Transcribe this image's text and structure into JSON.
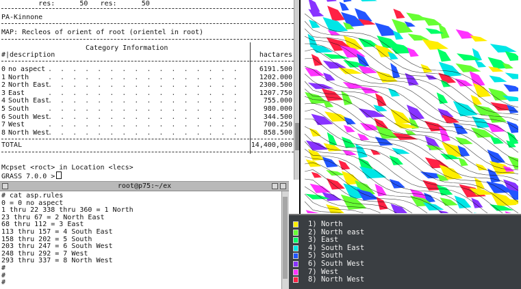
{
  "report": {
    "res_line": "         res:      50   res:      50",
    "mapset_label": "PA-Kinnone",
    "map_label": "MAP: Recleos of orient of root (orientel in root)",
    "category_header": "Category Information",
    "col_desc": "#|description",
    "col_hectares": "hactares",
    "rows": [
      {
        "num": "0",
        "desc": "no aspect",
        "value": "6191.500"
      },
      {
        "num": "1",
        "desc": "North",
        "value": "1202.000"
      },
      {
        "num": "2",
        "desc": "North East",
        "value": "2300.500"
      },
      {
        "num": "3",
        "desc": "East",
        "value": "1207.750"
      },
      {
        "num": "4",
        "desc": "South East",
        "value": "755.000"
      },
      {
        "num": "5",
        "desc": "South",
        "value": "980.000"
      },
      {
        "num": "6",
        "desc": "South West",
        "value": "344.500"
      },
      {
        "num": "7",
        "desc": "West",
        "value": "700.250"
      },
      {
        "num": "8",
        "desc": "North West",
        "value": "858.500"
      }
    ],
    "total_label": "TOTAL",
    "total_value": "14,400,000"
  },
  "prompt": {
    "line1": "Mcpset <roct> in Location <lecs>",
    "line2": "GRASS 7.0.0 >"
  },
  "terminal": {
    "title": "root@p75:~/ex",
    "lines": [
      "# cat asp.rules",
      "0 = 0 no aspect",
      "1 thru 22 338 thru 360 = 1 North",
      "23 thru 67 = 2 North East",
      "68 thru 112 = 3 East",
      "113 thru 157 = 4 South East",
      "158 thru 202 = 5 South",
      "203 thru 247 = 6 South West",
      "248 thru 292 = 7 West",
      "293 thru 337 = 8 North West",
      "#",
      "#",
      "#"
    ]
  },
  "legend": {
    "items": [
      {
        "label": "1) North",
        "color": "#ffee00"
      },
      {
        "label": "2) North east",
        "color": "#66ff33"
      },
      {
        "label": "3) East",
        "color": "#00ff66"
      },
      {
        "label": "4) South East",
        "color": "#00e6e6"
      },
      {
        "label": "5) South",
        "color": "#2255ff"
      },
      {
        "label": "6) South West",
        "color": "#8833ff"
      },
      {
        "label": "7) West",
        "color": "#ff33ff"
      },
      {
        "label": "8) North West",
        "color": "#ff2244"
      }
    ]
  },
  "map": {
    "palette": {
      "north": "#ffee00",
      "north_east": "#66ff33",
      "east": "#00ff66",
      "south_east": "#00e6e6",
      "south": "#2255ff",
      "south_west": "#8833ff",
      "west": "#ff33ff",
      "north_west": "#ff2244"
    }
  }
}
